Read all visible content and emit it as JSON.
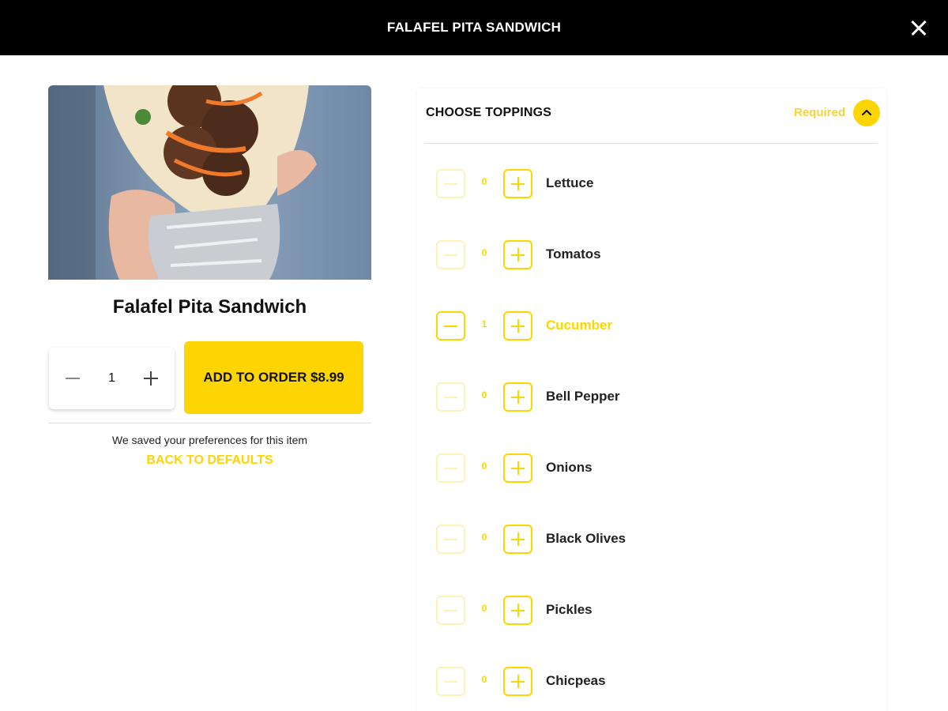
{
  "header": {
    "title": "FALAFEL PITA SANDWICH"
  },
  "item": {
    "name": "Falafel Pita Sandwich",
    "quantity": "1",
    "add_button_label": "ADD TO ORDER $8.99",
    "saved_note": "We saved your preferences for this item",
    "back_to_defaults_label": "BACK TO DEFAULTS"
  },
  "toppings": {
    "title": "CHOOSE TOPPINGS",
    "required_label": "Required",
    "items": [
      {
        "label": "Lettuce",
        "count": "0"
      },
      {
        "label": "Tomatos",
        "count": "0"
      },
      {
        "label": "Cucumber",
        "count": "1"
      },
      {
        "label": "Bell Pepper",
        "count": "0"
      },
      {
        "label": "Onions",
        "count": "0"
      },
      {
        "label": "Black Olives",
        "count": "0"
      },
      {
        "label": "Pickles",
        "count": "0"
      },
      {
        "label": "Chicpeas",
        "count": "0"
      }
    ]
  },
  "icons": {
    "close": "close-icon",
    "collapse": "chevron-up-icon",
    "minus": "minus-icon",
    "plus": "plus-icon"
  },
  "colors": {
    "accent": "#fed500",
    "header_bg": "#000000"
  }
}
